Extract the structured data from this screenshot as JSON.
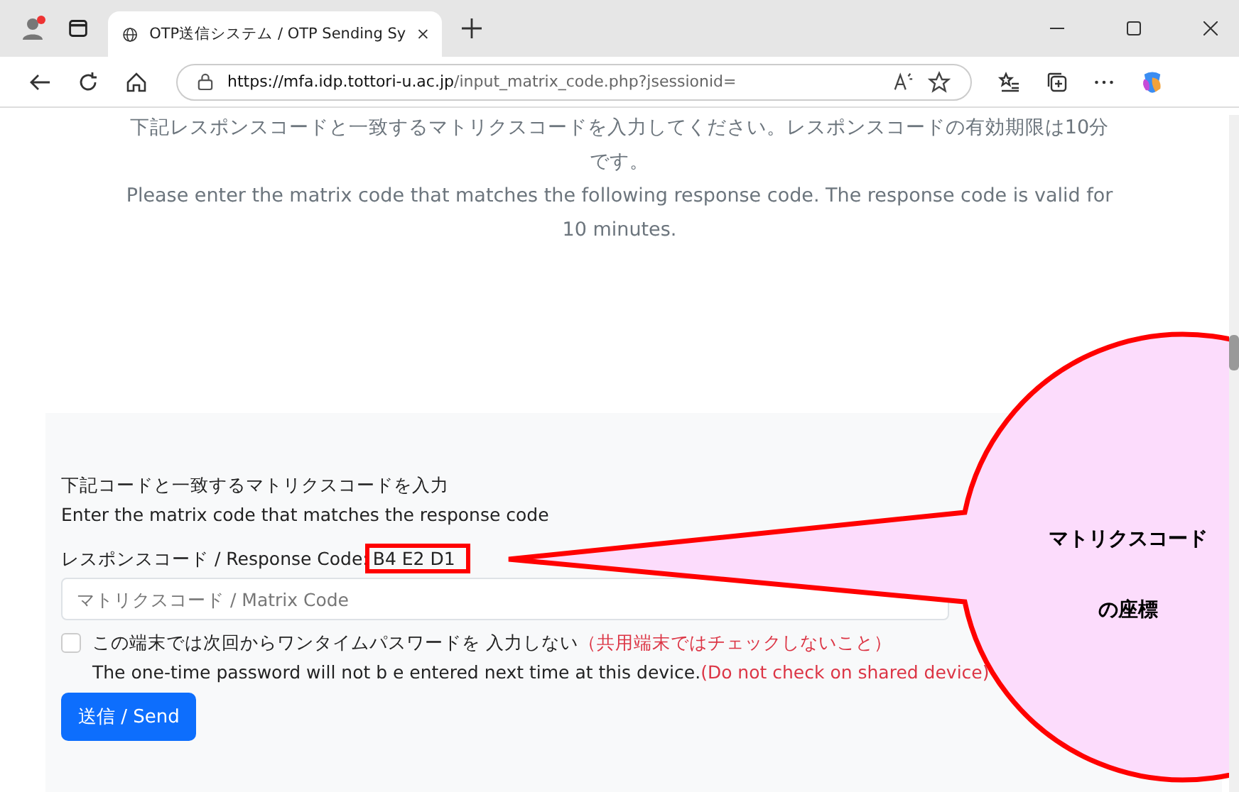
{
  "browser": {
    "tab_title": "OTP送信システム / OTP Sending Sy",
    "url_host": "https://mfa.idp.tottori-u.ac.jp",
    "url_path": "/input_matrix_code.php?jsessionid="
  },
  "intro": {
    "japanese": "下記レスポンスコードと一致するマトリクスコードを入力してください。レスポンスコードの有効期限は10分です。",
    "english": "Please enter the matrix code that matches the following response code. The response code is valid for 10 minutes."
  },
  "form": {
    "heading_ja": "下記コードと一致するマトリクスコードを入力",
    "heading_en": "Enter the matrix code that matches the response code",
    "response_label": "レスポンスコード / Response Code:",
    "response_code": "B4 E2 D1",
    "matrix_placeholder": "マトリクスコード / Matrix Code",
    "remember": {
      "checked": false,
      "label": "この端末では次回からワンタイムパスワードを 入力しない",
      "warning": "（共用端末ではチェックしないこと）",
      "label_en": "The one-time password will not b e entered next time at this device.",
      "warning_en": "(Do not check on shared device)"
    },
    "submit": "送信 / Send"
  },
  "callout": {
    "lines": [
      "マトリクスコード",
      "の座標"
    ]
  }
}
